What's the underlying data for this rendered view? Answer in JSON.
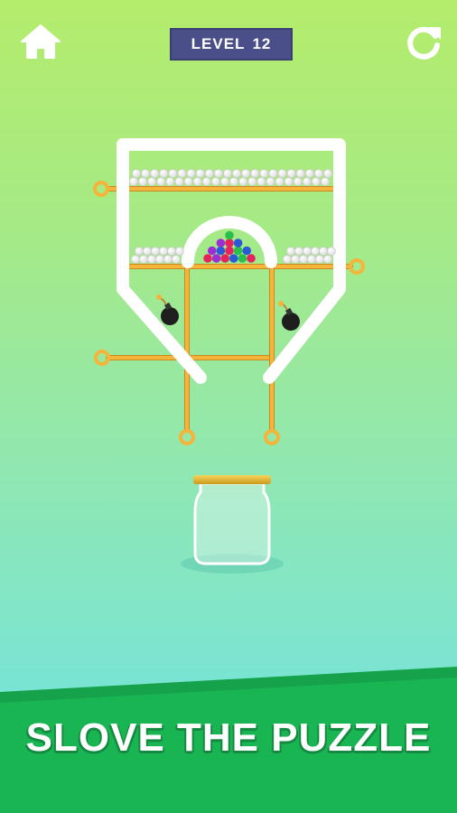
{
  "hud": {
    "level_label": "LEVEL",
    "level_number": "12",
    "home_icon": "home-icon",
    "restart_icon": "restart-icon"
  },
  "banner": {
    "text": "SLOVE THE PUZZLE"
  },
  "colors": {
    "background_top": "#b4ec6c",
    "background_bottom": "#6fe1de",
    "level_badge": "#4a4f8a",
    "pin": "#f5b43a",
    "banner_green": "#18b24f",
    "ball_white": "#ffffff",
    "bomb": "#1e1e1e"
  },
  "scene": {
    "white_balls_upper_shelf": 44,
    "white_balls_left_shelf": 12,
    "white_balls_right_shelf": 12,
    "colored_balls": [
      "#e5245e",
      "#9c2ed6",
      "#e5245e",
      "#2a5ad8",
      "#2abf4d",
      "#e5245e",
      "#9c2ed6",
      "#2a5ad8",
      "#e5245e",
      "#2abf4d",
      "#2a5ad8",
      "#9c2ed6",
      "#e5245e",
      "#2a5ad8",
      "#2abf4d"
    ],
    "bombs": 2,
    "pins": 5
  }
}
